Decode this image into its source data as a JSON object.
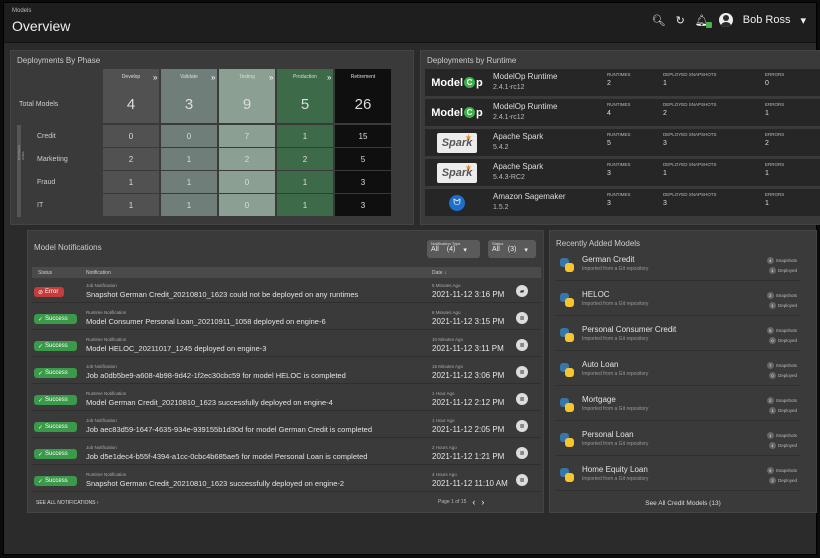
{
  "header": {
    "breadcrumb": "Models",
    "title": "Overview",
    "user": "Bob Ross"
  },
  "phases": {
    "title": "Deployments By Phase",
    "columns": [
      "Develop",
      "Validate",
      "Testing",
      "Production",
      "Retirement"
    ],
    "total_label": "Total Models",
    "totals": [
      "4",
      "3",
      "9",
      "5",
      "26"
    ],
    "side_label": "BUSINESS LINES",
    "rows": [
      {
        "label": "Credit",
        "values": [
          "0",
          "0",
          "7",
          "1",
          "15"
        ]
      },
      {
        "label": "Marketing",
        "values": [
          "2",
          "1",
          "2",
          "2",
          "5"
        ]
      },
      {
        "label": "Fraud",
        "values": [
          "1",
          "1",
          "0",
          "1",
          "3"
        ]
      },
      {
        "label": "IT",
        "values": [
          "1",
          "1",
          "0",
          "1",
          "3"
        ]
      }
    ],
    "colors": [
      "#515151",
      "#6f7e79",
      "#8ba092",
      "#3d6b49",
      "#0f0f0f"
    ]
  },
  "runtimes": {
    "title": "Deployments by Runtime",
    "col_runtimes": "RUNTIMES",
    "col_snapshots": "DEPLOYED SNAPSHOTS",
    "col_errors": "ERRORS",
    "rows": [
      {
        "logo": "ModelOp",
        "name": "ModelOp Runtime",
        "version": "2.4.1-rc12",
        "runtimes": "2",
        "snapshots": "1",
        "errors": "0"
      },
      {
        "logo": "ModelOp",
        "name": "ModelOp Runtime",
        "version": "2.4.1-rc12",
        "runtimes": "4",
        "snapshots": "2",
        "errors": "1"
      },
      {
        "logo": "Spark",
        "name": "Apache Spark",
        "version": "5.4.2",
        "runtimes": "5",
        "snapshots": "3",
        "errors": "2"
      },
      {
        "logo": "Spark",
        "name": "Apache Spark",
        "version": "5.4.3-RC2",
        "runtimes": "3",
        "snapshots": "1",
        "errors": "1"
      },
      {
        "logo": "sagemaker-icon",
        "name": "Amazon Sagemaker",
        "version": "1.5.2",
        "runtimes": "3",
        "snapshots": "3",
        "errors": "1"
      }
    ]
  },
  "notifications": {
    "title": "Model Notifications",
    "filter_type_label": "Notification Type",
    "filter_type_value": "All",
    "filter_type_count": "(4)",
    "filter_status_label": "Status",
    "filter_status_value": "All",
    "filter_status_count": "(3)",
    "col_status": "Status",
    "col_notification": "Notification",
    "col_date": "Date ↓",
    "rows": [
      {
        "status": "Error",
        "kind": "err",
        "type": "Job Notification",
        "message": "Snapshot German Credit_20210810_1623 could not be deployed on any runtimes",
        "ago": "5 Minutes Ago",
        "date": "2021-11-12 3:16 PM"
      },
      {
        "status": "Success",
        "kind": "ok",
        "type": "Runtime Notification",
        "message": "Model Consumer Personal Loan_20210911_1058 deployed on engine-6",
        "ago": "6 Minutes Ago",
        "date": "2021-11-12 3:15 PM"
      },
      {
        "status": "Success",
        "kind": "ok",
        "type": "Runtime Notification",
        "message": "Model HELOC_20211017_1245 deployed on engine-3",
        "ago": "10 Minutes Ago",
        "date": "2021-11-12 3:11 PM"
      },
      {
        "status": "Success",
        "kind": "ok",
        "type": "Job Notification",
        "message": "Job a0db5be9-a608-4b98-9d42-1f2ec30cbc59 for model HELOC is completed",
        "ago": "15 Minutes Ago",
        "date": "2021-11-12 3:06 PM"
      },
      {
        "status": "Success",
        "kind": "ok",
        "type": "Runtime Notification",
        "message": "Model German Credit_20210810_1623 successfully deployed on engine-4",
        "ago": "1 Hour Ago",
        "date": "2021-11-12 2:12 PM"
      },
      {
        "status": "Success",
        "kind": "ok",
        "type": "Job Notification",
        "message": "Job aec83d59-1647-4635-934e-939155b1d30d for model German Credit is completed",
        "ago": "1 Hour Ago",
        "date": "2021-11-12 2:05 PM"
      },
      {
        "status": "Success",
        "kind": "ok",
        "type": "Job Notification",
        "message": "Job d5e1dec4-b55f-4394-a1cc-0cbc4b685ae5 for model Personal Loan is completed",
        "ago": "2 Hours Ago",
        "date": "2021-11-12 1:21 PM"
      },
      {
        "status": "Success",
        "kind": "ok",
        "type": "Runtime Notification",
        "message": "Snapshot German Credit_20210810_1623 successfully deployed on engine-2",
        "ago": "4 Hours Ago",
        "date": "2021-11-12 11:10 AM"
      }
    ],
    "see_all": "SEE ALL NOTIFICATIONS  ›",
    "pager": "Page 1 of 15"
  },
  "recent": {
    "title": "Recently Added Models",
    "items": [
      {
        "name": "German Credit",
        "source": "Imported from a Git repository",
        "snapshots": "4",
        "deployed": "1"
      },
      {
        "name": "HELOC",
        "source": "Imported from a Git repository",
        "snapshots": "2",
        "deployed": "1"
      },
      {
        "name": "Personal Consumer Credit",
        "source": "Imported from a Git repository",
        "snapshots": "5",
        "deployed": "0"
      },
      {
        "name": "Auto Loan",
        "source": "Imported from a Git repository",
        "snapshots": "7",
        "deployed": "0"
      },
      {
        "name": "Mortgage",
        "source": "Imported from a Git repository",
        "snapshots": "2",
        "deployed": "1"
      },
      {
        "name": "Personal Loan",
        "source": "Imported from a Git repository",
        "snapshots": "1",
        "deployed": "1"
      },
      {
        "name": "Home Equity Loan",
        "source": "Imported from a Git repository",
        "snapshots": "9",
        "deployed": "2"
      }
    ],
    "snapshots_label": "Snapshots",
    "deployed_label": "Deployed",
    "see_all": "See All Credit Models (13)"
  }
}
